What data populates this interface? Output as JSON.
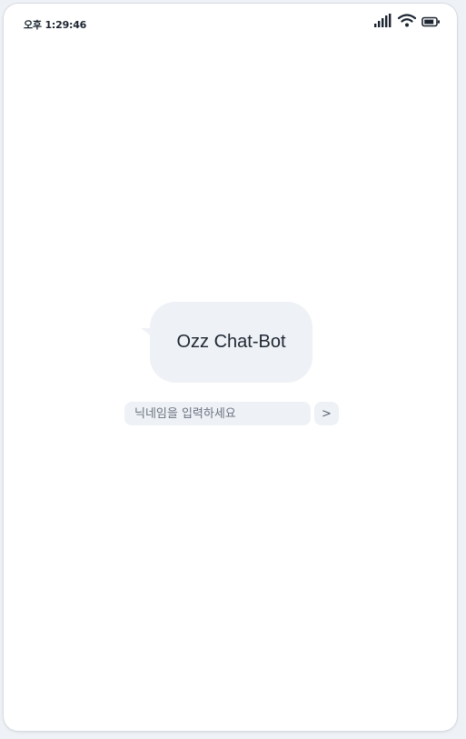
{
  "status_bar": {
    "time": "오후 1:29:46",
    "icons": [
      "signal-icon",
      "wifi-icon",
      "battery-icon"
    ]
  },
  "chat": {
    "bubble_title": "Ozz Chat-Bot"
  },
  "nickname_form": {
    "placeholder": "닉네임을 입력하세요",
    "value": "",
    "submit_label": ">"
  },
  "colors": {
    "background": "#ffffff",
    "bubble": "#eef1f5",
    "text": "#1d2733"
  }
}
